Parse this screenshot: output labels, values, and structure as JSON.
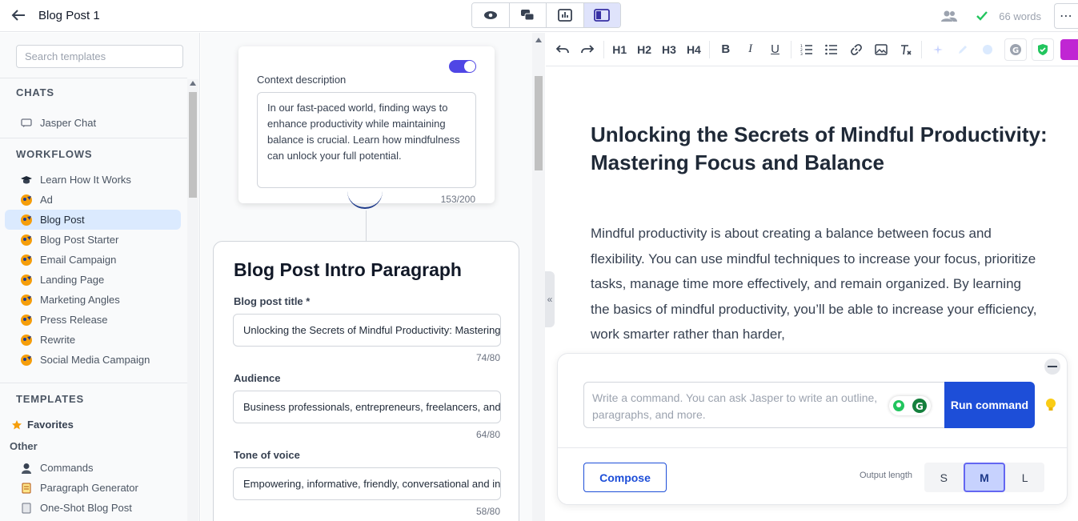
{
  "header": {
    "title": "Blog Post 1",
    "word_count": "66 words"
  },
  "sidebar": {
    "search_placeholder": "Search templates",
    "sections": {
      "chats": "CHATS",
      "workflows": "WORKFLOWS",
      "templates": "TEMPLATES"
    },
    "chats": [
      {
        "label": "Jasper Chat",
        "icon": "chat-icon"
      }
    ],
    "workflows": [
      {
        "label": "Learn How It Works",
        "icon": "graduation-cap-icon"
      },
      {
        "label": "Ad",
        "icon": "jasper-logo-icon"
      },
      {
        "label": "Blog Post",
        "icon": "jasper-logo-icon",
        "active": true
      },
      {
        "label": "Blog Post Starter",
        "icon": "jasper-logo-icon"
      },
      {
        "label": "Email Campaign",
        "icon": "jasper-logo-icon"
      },
      {
        "label": "Landing Page",
        "icon": "jasper-logo-icon"
      },
      {
        "label": "Marketing Angles",
        "icon": "jasper-logo-icon"
      },
      {
        "label": "Press Release",
        "icon": "jasper-logo-icon"
      },
      {
        "label": "Rewrite",
        "icon": "jasper-logo-icon"
      },
      {
        "label": "Social Media Campaign",
        "icon": "jasper-logo-icon"
      }
    ],
    "favorites": "Favorites",
    "other": "Other",
    "templates": [
      {
        "label": "Commands",
        "icon": "person-icon"
      },
      {
        "label": "Paragraph Generator",
        "icon": "scroll-icon"
      },
      {
        "label": "One-Shot Blog Post",
        "icon": "document-icon"
      }
    ]
  },
  "context": {
    "label": "Context description",
    "text": "In our fast-paced world, finding ways to enhance productivity while maintaining balance is crucial. Learn how mindfulness can unlock your full potential.",
    "count": "153/200"
  },
  "intro": {
    "title": "Blog Post Intro Paragraph",
    "fields": {
      "blog_title": {
        "label": "Blog post title *",
        "value": "Unlocking the Secrets of Mindful Productivity: Mastering Focus and Balance",
        "count": "74/80"
      },
      "audience": {
        "label": "Audience",
        "value": "Business professionals, entrepreneurs, freelancers, and students",
        "count": "64/80"
      },
      "tone": {
        "label": "Tone of voice",
        "value": "Empowering, informative, friendly, conversational and inspiring",
        "count": "58/80"
      }
    }
  },
  "editor": {
    "toolbar": {
      "h1": "H1",
      "h2": "H2",
      "h3": "H3",
      "h4": "H4",
      "bold": "B",
      "italic": "I",
      "underline": "U"
    },
    "heading": "Unlocking the Secrets of Mindful Productivity: Mastering Focus and Balance",
    "paragraph": "Mindful productivity is about creating a balance between focus and flexibility. You can use mindful techniques to increase your focus, prioritize tasks, manage time more effectively, and remain organized. By learning the basics of mindful productivity, you’ll be able to increase your efficiency, work smarter rather than harder,"
  },
  "command": {
    "placeholder": "Write a command. You can ask Jasper to write an outline, paragraphs, and more.",
    "run_label": "Run command",
    "compose_label": "Compose",
    "output_length_label": "Output length",
    "sizes": [
      "S",
      "M",
      "L"
    ],
    "selected_size": "M"
  },
  "colors": {
    "accent": "#1d4ed8",
    "toggle": "#4f46e5",
    "active_item": "#dbeafe",
    "check": "#22c55e"
  }
}
